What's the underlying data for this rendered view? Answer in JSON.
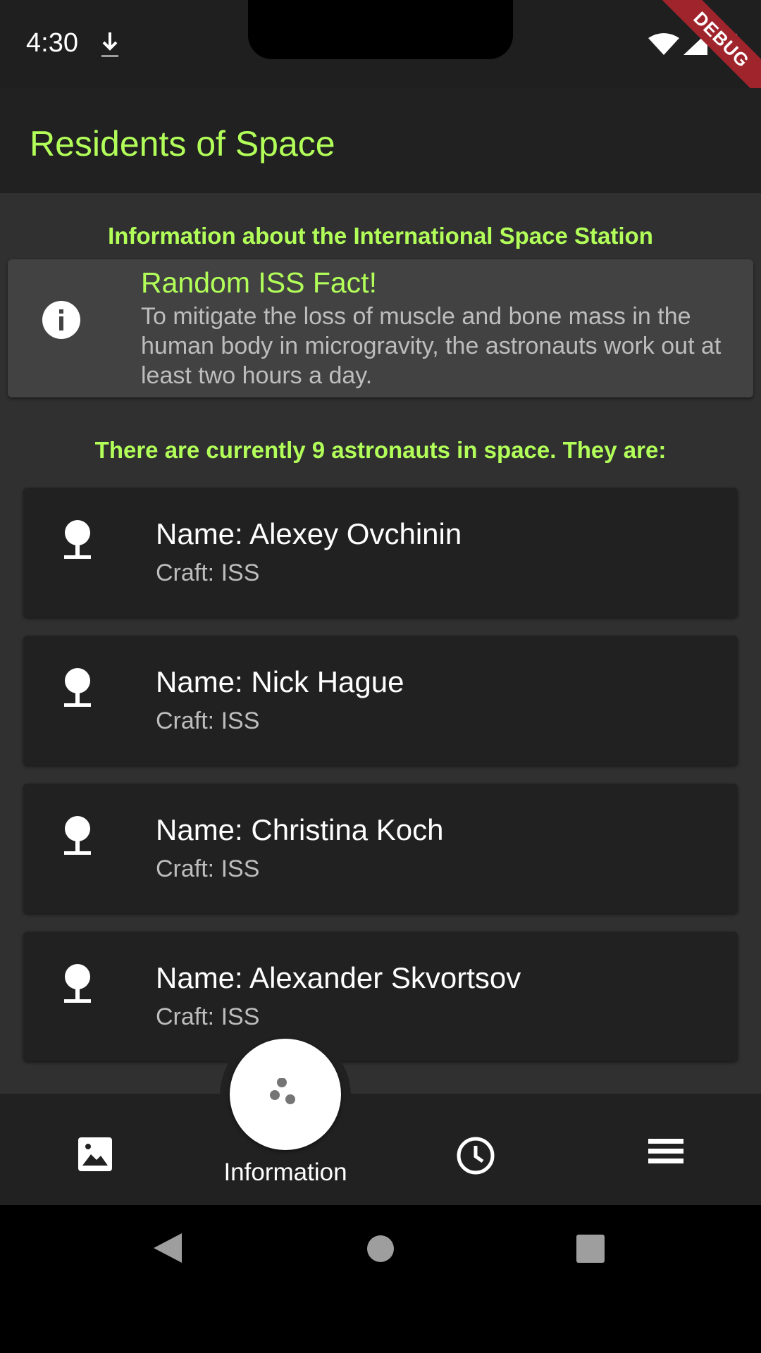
{
  "status_bar": {
    "time": "4:30",
    "debug_label": "DEBUG"
  },
  "app_bar": {
    "title": "Residents of Space"
  },
  "iss_section": {
    "heading": "Information about the International Space Station",
    "fact_title": "Random ISS Fact!",
    "fact_body": "To mitigate the loss of muscle and bone mass in the human body in microgravity, the astronauts work out at least two hours a day."
  },
  "astronauts": {
    "heading": "There are currently 9 astronauts in space. They are:",
    "list": [
      {
        "name": "Name: Alexey Ovchinin",
        "craft": "Craft: ISS"
      },
      {
        "name": "Name: Nick Hague",
        "craft": "Craft: ISS"
      },
      {
        "name": "Name: Christina Koch",
        "craft": "Craft: ISS"
      },
      {
        "name": "Name: Alexander Skvortsov",
        "craft": "Craft: ISS"
      }
    ]
  },
  "bottom_nav": {
    "items": [
      {
        "icon": "image-icon"
      },
      {
        "icon": "bubbles-icon",
        "label": "Information"
      },
      {
        "icon": "clock-icon"
      },
      {
        "icon": "menu-icon"
      }
    ]
  },
  "colors": {
    "accent": "#b2ff59",
    "surface": "#212121",
    "background": "#303030",
    "card": "#424242"
  }
}
